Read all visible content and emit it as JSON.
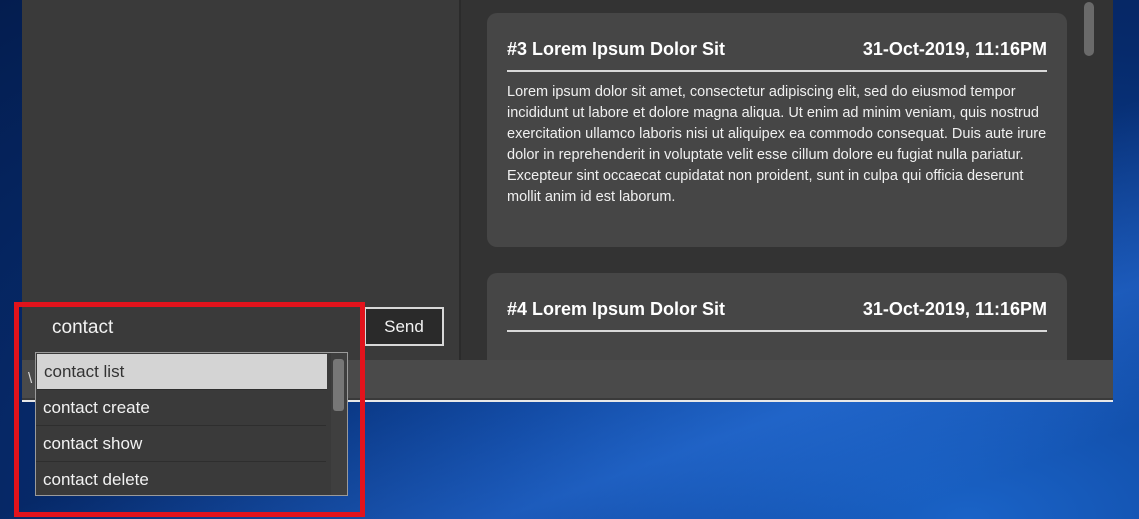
{
  "cards": [
    {
      "title": "#3 Lorem Ipsum Dolor Sit",
      "timestamp": "31-Oct-2019, 11:16PM",
      "body": "Lorem ipsum dolor sit amet, consectetur adipiscing elit, sed do eiusmod tempor incididunt ut labore et dolore magna aliqua. Ut enim ad minim veniam, quis nostrud exercitation ullamco laboris nisi ut aliquipex ea commodo consequat. Duis aute irure dolor in reprehenderit in voluptate velit esse cillum dolore eu fugiat nulla pariatur. Excepteur sint occaecat cupidatat non proident, sunt in culpa qui officia deserunt mollit anim id est laborum."
    },
    {
      "title": "#4 Lorem Ipsum Dolor Sit",
      "timestamp": "31-Oct-2019, 11:16PM",
      "body": ""
    }
  ],
  "command": {
    "value": "contact",
    "send_label": "Send"
  },
  "autocomplete": {
    "items": [
      "contact list",
      "contact create",
      "contact show",
      "contact delete"
    ],
    "selected_index": 0
  },
  "status": {
    "text": "\\"
  },
  "colors": {
    "highlight": "#e2131c",
    "app_bg": "#3a3a3a",
    "card_bg": "#464646"
  }
}
